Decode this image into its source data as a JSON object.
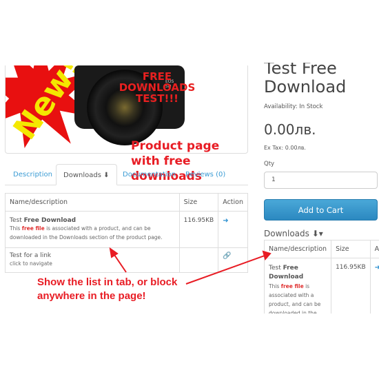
{
  "product_image": {
    "badge_text": "New!",
    "overlay_text": "FREE DOWNLOADS TEST!!!",
    "camera_model": "EOS 5D"
  },
  "annotations": {
    "top": "Product page with free downloads",
    "bottom_line1": "Show the list in tab, or block",
    "bottom_line2": "anywhere in the page!",
    "color": "#e81c24"
  },
  "tabs": [
    {
      "label": "Description"
    },
    {
      "label": "Downloads",
      "active": true,
      "icon": "download-icon"
    },
    {
      "label": "Documentation"
    },
    {
      "label": "Reviews (0)"
    }
  ],
  "downloads_table": {
    "headers": [
      "Name/description",
      "Size",
      "Action"
    ],
    "rows": [
      {
        "name_prefix": "Test ",
        "name_bold": "Free Download",
        "desc_pre": "This ",
        "desc_red": "free file",
        "desc_post": " is associated with a product, and can be downloaded in the Downloads section of the product page.",
        "size": "116.95KB",
        "action_icon": "sign-in-icon"
      },
      {
        "name_prefix": "Test for a link",
        "desc_post": "click to navigate",
        "size": "",
        "action_icon": "link-icon"
      }
    ]
  },
  "product": {
    "title": "Test Free Download",
    "availability": "Availability: In Stock",
    "price": "0.00лв.",
    "ex_tax": "Ex Tax: 0.00лв.",
    "qty_label": "Qty",
    "qty_value": "1",
    "add_to_cart": "Add to Cart",
    "accent": "#3a9bd4"
  },
  "downloads_block": {
    "title": "Downloads",
    "headers": [
      "Name/description",
      "Size",
      "Action"
    ],
    "row": {
      "name_prefix": "Test ",
      "name_bold": "Free Download",
      "desc_pre": "This ",
      "desc_red": "free file",
      "desc_post": " is associated with a product, and can be downloaded in the Downloads section of the product page.",
      "size": "116.95KB"
    }
  }
}
